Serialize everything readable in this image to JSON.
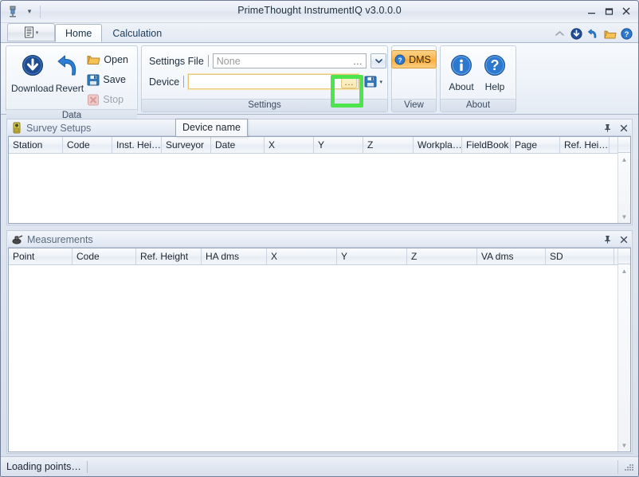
{
  "window": {
    "title": "PrimeThought InstrumentIQ v3.0.0.0",
    "app_icon": "instrument-icon",
    "qat_dropdown_icon": "chevron-down-icon",
    "minimize_label": "—",
    "maximize_label": "❐",
    "close_label": "✕"
  },
  "tabs": {
    "app_menu_icon": "document-menu-icon",
    "app_menu_caret": "▾",
    "items": [
      {
        "label": "Home",
        "active": true
      },
      {
        "label": "Calculation",
        "active": false
      }
    ],
    "right_icons": [
      {
        "name": "collapse-ribbon-icon",
        "glyph": "⌃"
      },
      {
        "name": "download-icon",
        "glyph": "⬇"
      },
      {
        "name": "revert-icon",
        "glyph": "↩"
      },
      {
        "name": "open-folder-icon",
        "glyph": "📂"
      },
      {
        "name": "help-icon",
        "glyph": "?"
      }
    ]
  },
  "ribbon": {
    "groups": [
      {
        "title": "Data",
        "big_buttons": [
          {
            "label": "Download",
            "icon": "download-circle-icon"
          },
          {
            "label": "Revert",
            "icon": "revert-arrow-icon"
          }
        ],
        "small_buttons": [
          {
            "label": "Open",
            "icon": "open-folder-icon",
            "disabled": false
          },
          {
            "label": "Save",
            "icon": "save-disk-icon",
            "disabled": false
          },
          {
            "label": "Stop",
            "icon": "stop-x-icon",
            "disabled": true
          }
        ]
      },
      {
        "title": "Settings",
        "rows": [
          {
            "label": "Settings File",
            "value": "",
            "placeholder": "None",
            "inline_button": "…",
            "drop_button": "▾"
          },
          {
            "label": "Device",
            "value": "",
            "placeholder": "",
            "inline_button": "…",
            "split_icon": "save-disk-icon",
            "split_caret": "▾"
          }
        ]
      },
      {
        "title": "View",
        "toggle": {
          "label": "DMS",
          "icon": "dms-question-icon",
          "active": true
        }
      },
      {
        "title": "About",
        "big_buttons": [
          {
            "label": "About",
            "icon": "info-circle-icon"
          },
          {
            "label": "Help",
            "icon": "help-circle-icon"
          }
        ]
      }
    ]
  },
  "highlight": {
    "color": "#4ee44e"
  },
  "tooltip": {
    "text": "Device name"
  },
  "panels": [
    {
      "title": "Survey Setups",
      "icon": "survey-setup-icon",
      "pin_glyph": "📌",
      "close_glyph": "✕",
      "columns": [
        {
          "label": "Station",
          "width": 68
        },
        {
          "label": "Code",
          "width": 62
        },
        {
          "label": "Inst. Hei…",
          "width": 62
        },
        {
          "label": "Surveyor",
          "width": 62
        },
        {
          "label": "Date",
          "width": 67
        },
        {
          "label": "X",
          "width": 62
        },
        {
          "label": "Y",
          "width": 62
        },
        {
          "label": "Z",
          "width": 63
        },
        {
          "label": "Workpla…",
          "width": 61
        },
        {
          "label": "FieldBook",
          "width": 61
        },
        {
          "label": "Page",
          "width": 62
        },
        {
          "label": "Ref. Hei…",
          "width": 62
        }
      ],
      "rows": []
    },
    {
      "title": "Measurements",
      "icon": "measurements-icon",
      "pin_glyph": "📌",
      "close_glyph": "✕",
      "columns": [
        {
          "label": "Point",
          "width": 80
        },
        {
          "label": "Code",
          "width": 80
        },
        {
          "label": "Ref. Height",
          "width": 82
        },
        {
          "label": "HA dms",
          "width": 82
        },
        {
          "label": "X",
          "width": 88
        },
        {
          "label": "Y",
          "width": 88
        },
        {
          "label": "Z",
          "width": 88
        },
        {
          "label": "VA dms",
          "width": 86
        },
        {
          "label": "SD",
          "width": 86
        }
      ],
      "rows": []
    }
  ],
  "statusbar": {
    "message": "Loading points…",
    "grip": "resize-grip-icon"
  }
}
